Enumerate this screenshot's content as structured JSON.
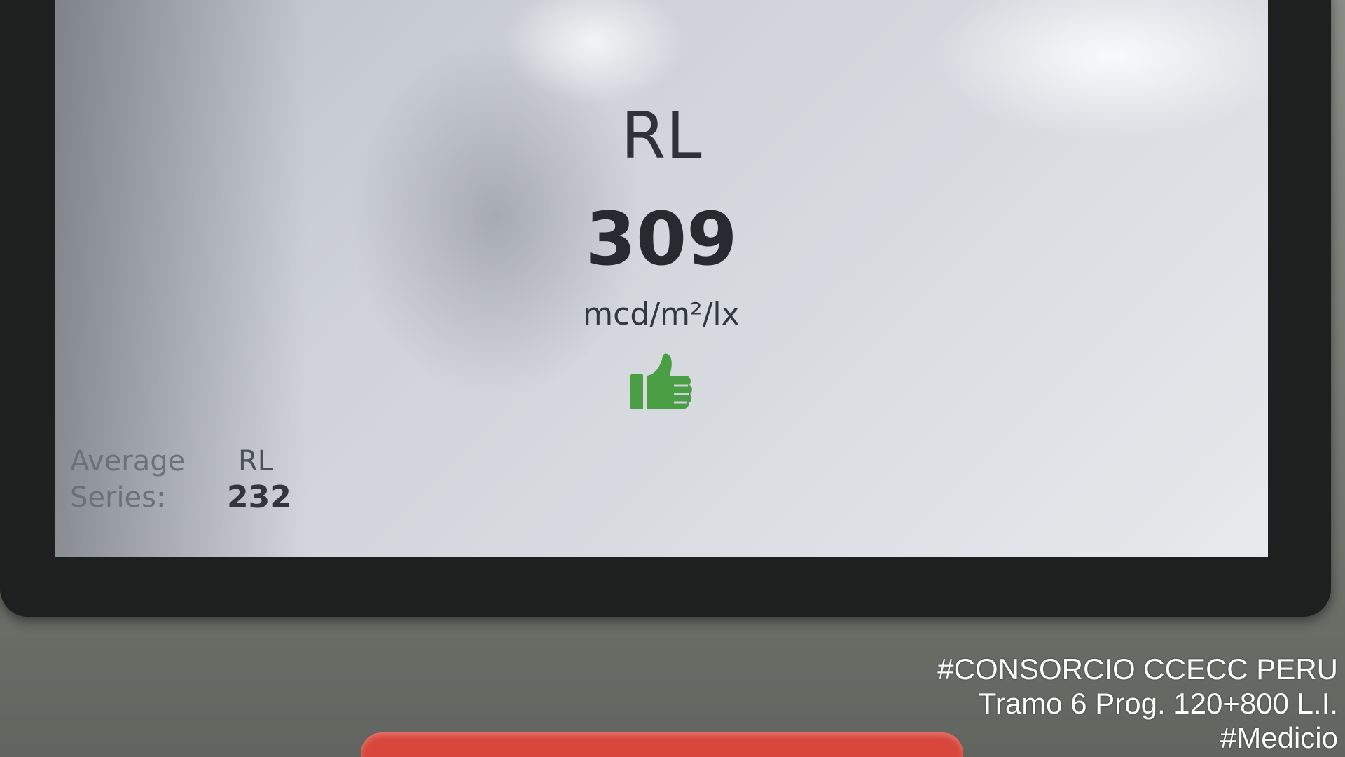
{
  "display": {
    "measurement_label": "RL",
    "measurement_value": "309",
    "unit": "mcd/m²/lx",
    "result_icon": "thumbs-up-icon",
    "result_color": "#4a9e43"
  },
  "average": {
    "label_line1": "Average",
    "label_line2": "Series:",
    "metric": "RL",
    "value": "232"
  },
  "watermark": {
    "line1": "#CONSORCIO CCECC PERU",
    "line2": "Tramo 6 Prog. 120+800 L.I.",
    "line3": "#Medicio"
  }
}
